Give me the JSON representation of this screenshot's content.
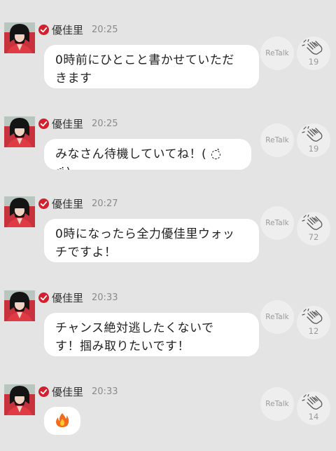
{
  "posts": [
    {
      "author": "優佳里",
      "time": "20:25",
      "lines": [
        "0時前にひとこと書かせていただ",
        "きます"
      ],
      "retalk_label": "ReTalk",
      "clap_count": "19"
    },
    {
      "author": "優佳里",
      "time": "20:25",
      "lines": [
        "みなさん待機していてね！( ◌̇ ◌̇)"
      ],
      "retalk_label": "ReTalk",
      "clap_count": "19"
    },
    {
      "author": "優佳里",
      "time": "20:27",
      "lines": [
        "0時になったら全力優佳里ウォッ",
        "チですよ！"
      ],
      "retalk_label": "ReTalk",
      "clap_count": "72"
    },
    {
      "author": "優佳里",
      "time": "20:33",
      "lines": [
        "チャンス絶対逃したくないで",
        "す！掴み取りたいです！"
      ],
      "retalk_label": "ReTalk",
      "clap_count": "12"
    },
    {
      "author": "優佳里",
      "time": "20:33",
      "emoji": "fire-emoji",
      "retalk_label": "ReTalk",
      "clap_count": "14"
    }
  ],
  "icons": {
    "avatar": "profile-photo",
    "verified": "verified-check-icon",
    "clap": "clapping-hands-icon"
  },
  "colors": {
    "background": "#e4e4e4",
    "bubble": "#ffffff",
    "verified": "#d3202f",
    "action_button": "#eeeeee"
  }
}
